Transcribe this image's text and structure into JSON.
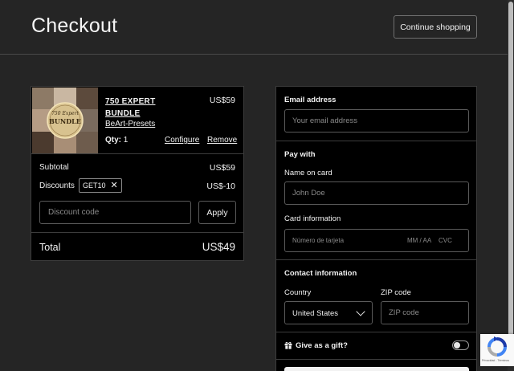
{
  "header": {
    "title": "Checkout",
    "continue_label": "Continue shopping"
  },
  "cart": {
    "item": {
      "name_line1": "750 EXPERT",
      "name_line2": "BUNDLE",
      "price": "US$59",
      "vendor": "BeArt-Presets",
      "qty_label": "Qty:",
      "qty_value": "1",
      "configure_label": "Configure",
      "remove_label": "Remove",
      "thumb_title": "750 Expert",
      "thumb_badge": "BUNDLE"
    },
    "subtotal_label": "Subtotal",
    "subtotal_value": "US$59",
    "discounts_label": "Discounts",
    "discount_code": "GET10",
    "discount_value": "US$-10",
    "discount_placeholder": "Discount code",
    "apply_label": "Apply",
    "total_label": "Total",
    "total_value": "US$49"
  },
  "form": {
    "email_label": "Email address",
    "email_placeholder": "Your email address",
    "pay_with_label": "Pay with",
    "name_label": "Name on card",
    "name_placeholder": "John Doe",
    "card_label": "Card information",
    "card_number_placeholder": "Número de tarjeta",
    "card_exp_placeholder": "MM / AA",
    "card_cvc_placeholder": "CVC",
    "contact_label": "Contact information",
    "country_label": "Country",
    "country_value": "United States",
    "zip_label": "ZIP code",
    "zip_placeholder": "ZIP code",
    "gift_label": "Give as a gift?",
    "gift_enabled": false
  },
  "recaptcha": {
    "text": "Privacidad - Términos"
  },
  "colors": {
    "background": "#252525",
    "panel": "#000000",
    "border": "#3c3c3c"
  }
}
